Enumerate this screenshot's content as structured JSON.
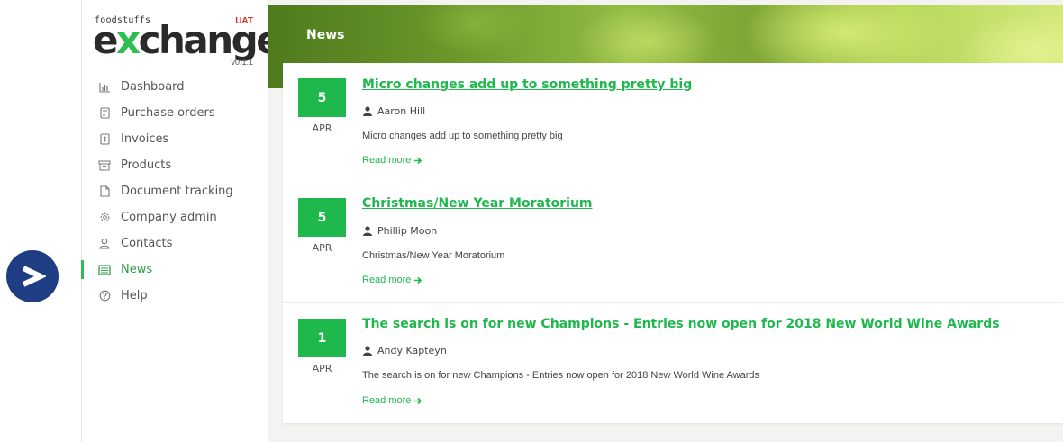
{
  "brand": {
    "top_text": "foodstuffs",
    "env_badge": "UAT",
    "name_first": "e",
    "name_x": "x",
    "name_rest": "change",
    "version": "v0.1.1"
  },
  "sidebar": {
    "items": [
      {
        "label": "Dashboard",
        "icon": "bar-chart-icon",
        "active": false
      },
      {
        "label": "Purchase orders",
        "icon": "document-list-icon",
        "active": false
      },
      {
        "label": "Invoices",
        "icon": "invoice-icon",
        "active": false
      },
      {
        "label": "Products",
        "icon": "box-icon",
        "active": false
      },
      {
        "label": "Document tracking",
        "icon": "file-icon",
        "active": false
      },
      {
        "label": "Company admin",
        "icon": "gear-icon",
        "active": false
      },
      {
        "label": "Contacts",
        "icon": "user-icon",
        "active": false
      },
      {
        "label": "News",
        "icon": "newspaper-icon",
        "active": true
      },
      {
        "label": "Help",
        "icon": "help-circle-icon",
        "active": false
      }
    ]
  },
  "header": {
    "title": "News"
  },
  "news": [
    {
      "day": "5",
      "month": "APR",
      "title": "Micro changes add up to something pretty big",
      "author": "Aaron Hill",
      "summary": "Micro changes add up to something pretty big",
      "read_more": "Read more"
    },
    {
      "day": "5",
      "month": "APR",
      "title": "Christmas/New Year Moratorium",
      "author": "Phillip Moon",
      "summary": "Christmas/New Year Moratorium",
      "read_more": "Read more"
    },
    {
      "day": "1",
      "month": "APR",
      "title": "The search is on for new Champions - Entries now open for 2018 New World Wine Awards",
      "author": "Andy Kapteyn",
      "summary": "The search is on for new Champions - Entries now open for 2018 New World Wine Awards",
      "read_more": "Read more"
    }
  ],
  "colors": {
    "accent": "#1fb84d",
    "brand_navy": "#1f3d82",
    "uat_red": "#d0312d"
  }
}
